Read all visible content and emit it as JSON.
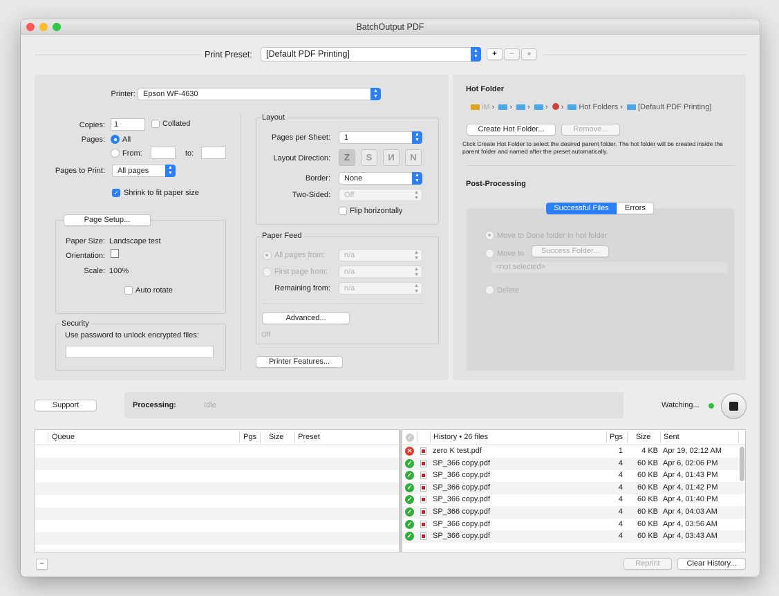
{
  "window": {
    "title": "BatchOutput PDF"
  },
  "preset": {
    "label": "Print Preset:",
    "value": "[Default PDF Printing]",
    "add": "+",
    "remove": "−"
  },
  "printer": {
    "label": "Printer:",
    "value": "Epson WF-4630",
    "copies_label": "Copies:",
    "copies_value": "1",
    "collated": "Collated",
    "pages_label": "Pages:",
    "all": "All",
    "from": "From:",
    "to": "to:",
    "pages_to_print_label": "Pages to Print:",
    "pages_to_print_value": "All pages",
    "shrink": "Shrink to fit paper size",
    "page_setup": "Page Setup...",
    "paper_size_label": "Paper Size:",
    "paper_size_value": "Landscape test",
    "orientation_label": "Orientation:",
    "scale_label": "Scale:",
    "scale_value": "100%",
    "auto_rotate": "Auto rotate",
    "security_title": "Security",
    "security_text": "Use password to unlock encrypted files:",
    "layout_title": "Layout",
    "pages_per_sheet_label": "Pages per Sheet:",
    "pages_per_sheet_value": "1",
    "layout_direction_label": "Layout Direction:",
    "border_label": "Border:",
    "border_value": "None",
    "two_sided_label": "Two-Sided:",
    "two_sided_value": "Off",
    "flip": "Flip horizontally",
    "paper_feed_title": "Paper Feed",
    "all_pages_from": "All pages from:",
    "first_page_from": "First page from:",
    "remaining_from": "Remaining from:",
    "na": "n/a",
    "advanced": "Advanced...",
    "advanced_status": "Off",
    "printer_features": "Printer Features..."
  },
  "hot_folder": {
    "title": "Hot Folder",
    "path_start": "iM",
    "path_folder": "Hot Folders",
    "path_end": "[Default PDF Printing]",
    "create": "Create Hot Folder...",
    "remove": "Remove...",
    "description": "Click Create Hot Folder to select the desired parent folder. The hot folder will be created inside the parent folder and named after the preset automatically.",
    "post_title": "Post-Processing",
    "tab_success": "Successful Files",
    "tab_errors": "Errors",
    "move_done": "Move to Done folder in hot folder",
    "move_to": "Move to",
    "success_folder": "Success Folder...",
    "not_selected": "<not selected>",
    "delete": "Delete"
  },
  "status": {
    "support": "Support",
    "processing_label": "Processing:",
    "processing_value": "Idle",
    "watching": "Watching..."
  },
  "queue": {
    "headers": [
      "Queue",
      "Pgs",
      "Size",
      "Preset"
    ]
  },
  "history": {
    "headers": [
      "History • 26 files",
      "Pgs",
      "Size",
      "Sent"
    ],
    "rows": [
      {
        "status": "error",
        "name": "zero K test.pdf",
        "pgs": "1",
        "size": "4 KB",
        "sent": "Apr 19, 02:12 AM"
      },
      {
        "status": "ok",
        "name": "SP_366 copy.pdf",
        "pgs": "4",
        "size": "60 KB",
        "sent": "Apr 6, 02:06 PM"
      },
      {
        "status": "ok",
        "name": "SP_366 copy.pdf",
        "pgs": "4",
        "size": "60 KB",
        "sent": "Apr 4, 01:43 PM"
      },
      {
        "status": "ok",
        "name": "SP_366 copy.pdf",
        "pgs": "4",
        "size": "60 KB",
        "sent": "Apr 4, 01:42 PM"
      },
      {
        "status": "ok",
        "name": "SP_366 copy.pdf",
        "pgs": "4",
        "size": "60 KB",
        "sent": "Apr 4, 01:40 PM"
      },
      {
        "status": "ok",
        "name": "SP_366 copy.pdf",
        "pgs": "4",
        "size": "60 KB",
        "sent": "Apr 4, 04:03 AM"
      },
      {
        "status": "ok",
        "name": "SP_366 copy.pdf",
        "pgs": "4",
        "size": "60 KB",
        "sent": "Apr 4, 03:56 AM"
      },
      {
        "status": "ok",
        "name": "SP_366 copy.pdf",
        "pgs": "4",
        "size": "60 KB",
        "sent": "Apr 4, 03:43 AM"
      }
    ]
  },
  "footer": {
    "remove": "−",
    "reprint": "Reprint",
    "clear": "Clear History..."
  },
  "colors": {
    "accent": "#2d7ff5",
    "ok": "#34ae3a",
    "error": "#e23b30",
    "watching": "#2fc141"
  }
}
